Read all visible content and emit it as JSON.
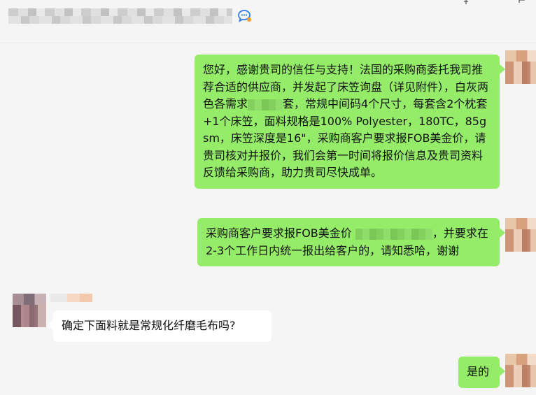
{
  "header": {
    "title_redacted": true,
    "chat_icon": "chat-bubble-icon"
  },
  "messages": [
    {
      "side": "right",
      "parts": [
        "您好，感谢贵司的信任与支持！法国的采购商委托我司推荐合适的供应商，并发起了床笠询盘（详见附件），白灰两色各需求",
        "套，常规中间码4个尺寸，每套含2个枕套+1个床笠，面料规格是100% Polyester，180TC，85gsm，床笠深度是16\"，采购商客户要求报FOB美金价，请贵司核对并报价，我们会第一时间将报价信息及贵司资料反馈给采购商，助力贵司尽快成单。"
      ]
    },
    {
      "side": "right",
      "parts": [
        "采购商客户要求报FOB美金价",
        "，并要求在2-3个工作日内统一报出给客户的，请知悉哈，谢谢"
      ]
    },
    {
      "side": "left",
      "text": "确定下面料就是常规化纤磨毛布吗?"
    },
    {
      "side": "right",
      "text": "是的"
    }
  ]
}
